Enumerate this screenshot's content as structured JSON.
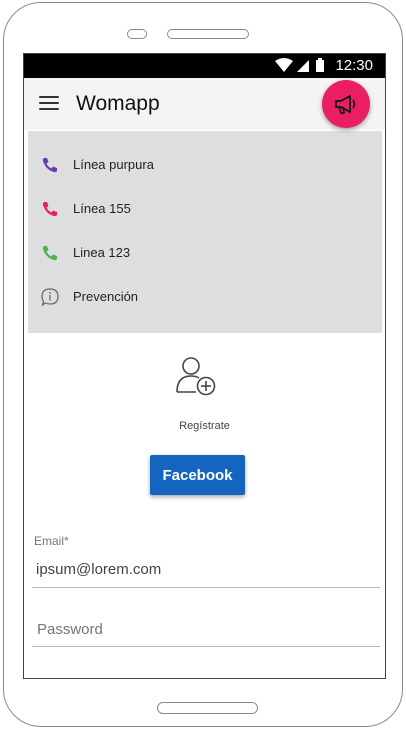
{
  "status_bar": {
    "time": "12:30"
  },
  "app_bar": {
    "title": "Womapp"
  },
  "drawer": {
    "items": [
      {
        "label": "Línea purpura",
        "icon": "phone-icon",
        "color": "#673ab7"
      },
      {
        "label": "Línea 155",
        "icon": "phone-icon",
        "color": "#e91e63"
      },
      {
        "label": "Linea 123",
        "icon": "phone-icon",
        "color": "#4caf50"
      },
      {
        "label": "Prevención",
        "icon": "info-chat-icon",
        "color": "#666666"
      }
    ]
  },
  "register": {
    "label": "Regístrate",
    "icon": "add-user-icon"
  },
  "facebook_button": {
    "label": "Facebook"
  },
  "form": {
    "email_label": "Email*",
    "email_value": "ipsum@lorem.com",
    "password_placeholder": "Password"
  },
  "colors": {
    "accent": "#e91e63",
    "facebook": "#1565c0",
    "drawer_bg": "#dedede"
  },
  "fab": {
    "icon": "megaphone-icon"
  }
}
